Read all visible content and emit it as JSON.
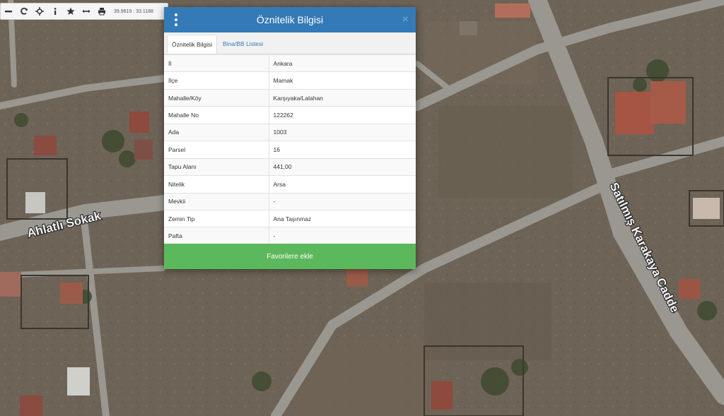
{
  "toolbar": {
    "coords": "39.9619 : 33.1188",
    "buttons": [
      "minus-icon",
      "refresh-icon",
      "move-icon",
      "info-icon",
      "star-icon",
      "measure-icon",
      "print-icon"
    ]
  },
  "map": {
    "streets": [
      "Ahlatlı Sokak",
      "Satılmış Karakaya Cadde"
    ]
  },
  "modal": {
    "title": "Öznitelik Bilgisi",
    "close": "×",
    "tabs": [
      {
        "label": "Öznitelik Bilgisi",
        "active": true
      },
      {
        "label": "Bina/BB Listesi",
        "active": false
      }
    ],
    "rows": [
      {
        "key": "İl",
        "value": "Ankara"
      },
      {
        "key": "İlçe",
        "value": "Mamak"
      },
      {
        "key": "Mahalle/Köy",
        "value": "Karşıyaka/Lalahan"
      },
      {
        "key": "Mahalle No",
        "value": "122262"
      },
      {
        "key": "Ada",
        "value": "1003"
      },
      {
        "key": "Parsel",
        "value": "16"
      },
      {
        "key": "Tapu Alanı",
        "value": "441,00"
      },
      {
        "key": "Nitelik",
        "value": "Arsa"
      },
      {
        "key": "Mevkii",
        "value": "-"
      },
      {
        "key": "Zemin Tip",
        "value": "Ana Taşınmaz"
      },
      {
        "key": "Pafta",
        "value": "-"
      }
    ],
    "favorite_label": "Favorilere ekle"
  },
  "colors": {
    "header": "#337ab7",
    "favorite": "#5cb85c",
    "road": "#9a9790",
    "terrain": "#6d6356"
  }
}
